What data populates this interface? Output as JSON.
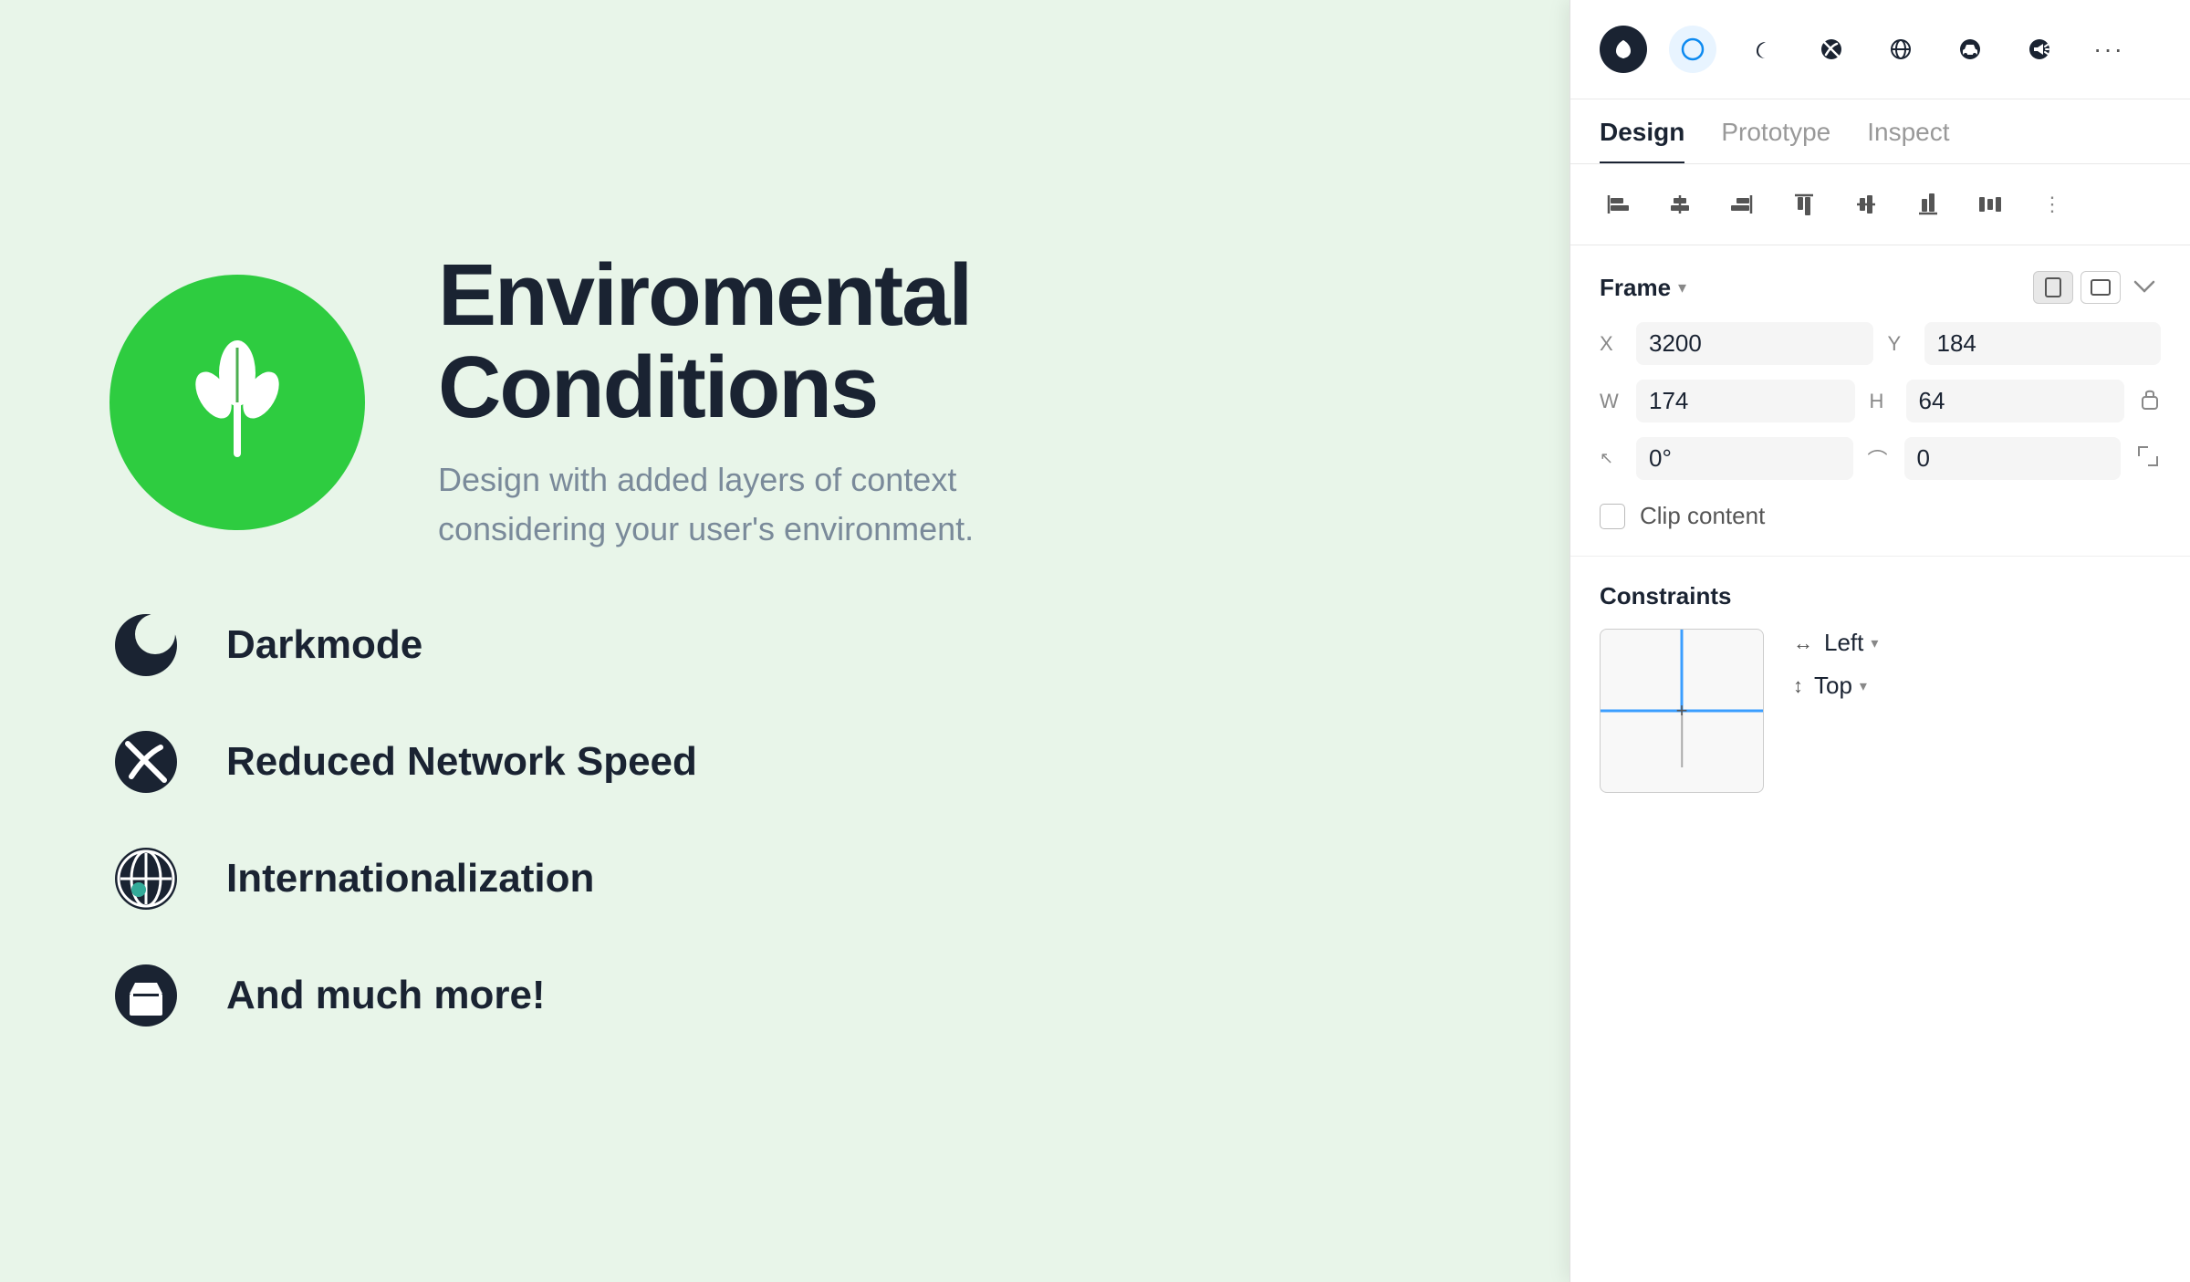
{
  "background_color": "#e8f5e9",
  "hero": {
    "title": "Enviromental\nConditions",
    "subtitle": "Design with added layers of context considering your user's environment.",
    "logo_alt": "green plant logo"
  },
  "features": [
    {
      "id": "darkmode",
      "label": "Darkmode",
      "icon": "moon"
    },
    {
      "id": "network",
      "label": "Reduced Network Speed",
      "icon": "no-signal"
    },
    {
      "id": "i18n",
      "label": "Internationalization",
      "icon": "globe"
    },
    {
      "id": "more",
      "label": "And much more!",
      "icon": "box"
    }
  ],
  "panel": {
    "toolbar_icons": [
      "leaf",
      "circle-active",
      "moon",
      "no-signal",
      "globe",
      "car",
      "megaphone",
      "more"
    ],
    "tabs": [
      {
        "id": "design",
        "label": "Design",
        "active": true
      },
      {
        "id": "prototype",
        "label": "Prototype",
        "active": false
      },
      {
        "id": "inspect",
        "label": "Inspect",
        "active": false
      }
    ],
    "align_icons": [
      "align-left",
      "align-center-v",
      "align-right",
      "align-top",
      "align-center-h",
      "align-bottom",
      "distribute"
    ],
    "frame_section": {
      "title": "Frame",
      "x_label": "X",
      "x_value": "3200",
      "y_label": "Y",
      "y_value": "184",
      "w_label": "W",
      "w_value": "174",
      "h_label": "H",
      "h_value": "64",
      "rotation_label": "↖",
      "rotation_value": "0°",
      "corner_label": "⌒",
      "corner_value": "0",
      "clip_label": "Clip content"
    },
    "constraints_section": {
      "title": "Constraints",
      "horizontal_label": "Left",
      "vertical_label": "Top"
    }
  }
}
